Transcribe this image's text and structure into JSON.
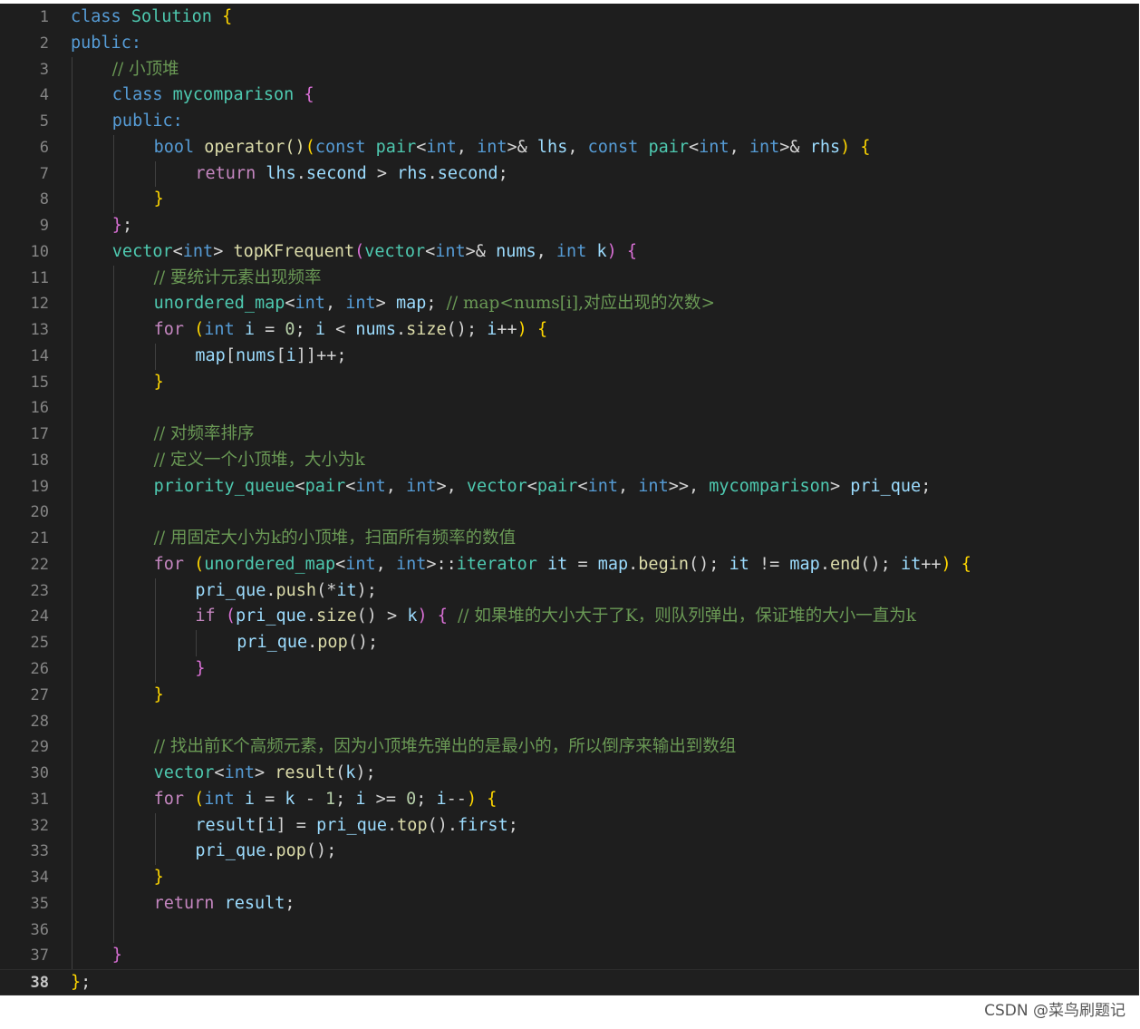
{
  "watermark": "CSDN @菜鸟刷题记",
  "active_line": 38,
  "lines": [
    {
      "n": "1",
      "indent": 0,
      "tokens": [
        [
          "kw",
          "class"
        ],
        [
          "tx",
          " "
        ],
        [
          "ty",
          "Solution"
        ],
        [
          "tx",
          " "
        ],
        [
          "br",
          "{"
        ]
      ]
    },
    {
      "n": "2",
      "indent": 0,
      "tokens": [
        [
          "kw",
          "public:"
        ]
      ]
    },
    {
      "n": "3",
      "indent": 1,
      "tokens": [
        [
          "cm",
          "// 小顶堆"
        ]
      ]
    },
    {
      "n": "4",
      "indent": 1,
      "tokens": [
        [
          "kw",
          "class"
        ],
        [
          "tx",
          " "
        ],
        [
          "ty",
          "mycomparison"
        ],
        [
          "tx",
          " "
        ],
        [
          "br2",
          "{"
        ]
      ]
    },
    {
      "n": "5",
      "indent": 1,
      "tokens": [
        [
          "kw",
          "public:"
        ]
      ]
    },
    {
      "n": "6",
      "indent": 2,
      "tokens": [
        [
          "kw",
          "bool"
        ],
        [
          "tx",
          " "
        ],
        [
          "fn",
          "operator()"
        ],
        [
          "br",
          "("
        ],
        [
          "kw",
          "const"
        ],
        [
          "tx",
          " "
        ],
        [
          "ty",
          "pair"
        ],
        [
          "tx",
          "<"
        ],
        [
          "kw",
          "int"
        ],
        [
          "tx",
          ", "
        ],
        [
          "kw",
          "int"
        ],
        [
          "tx",
          ">& "
        ],
        [
          "vr",
          "lhs"
        ],
        [
          "tx",
          ", "
        ],
        [
          "kw",
          "const"
        ],
        [
          "tx",
          " "
        ],
        [
          "ty",
          "pair"
        ],
        [
          "tx",
          "<"
        ],
        [
          "kw",
          "int"
        ],
        [
          "tx",
          ", "
        ],
        [
          "kw",
          "int"
        ],
        [
          "tx",
          ">& "
        ],
        [
          "vr",
          "rhs"
        ],
        [
          "br",
          ")"
        ],
        [
          "tx",
          " "
        ],
        [
          "br",
          "{"
        ]
      ]
    },
    {
      "n": "7",
      "indent": 3,
      "tokens": [
        [
          "ctl",
          "return"
        ],
        [
          "tx",
          " "
        ],
        [
          "vr",
          "lhs"
        ],
        [
          "tx",
          "."
        ],
        [
          "vr",
          "second"
        ],
        [
          "tx",
          " > "
        ],
        [
          "vr",
          "rhs"
        ],
        [
          "tx",
          "."
        ],
        [
          "vr",
          "second"
        ],
        [
          "tx",
          ";"
        ]
      ]
    },
    {
      "n": "8",
      "indent": 2,
      "tokens": [
        [
          "br",
          "}"
        ]
      ]
    },
    {
      "n": "9",
      "indent": 1,
      "tokens": [
        [
          "br2",
          "}"
        ],
        [
          "tx",
          ";"
        ]
      ]
    },
    {
      "n": "10",
      "indent": 1,
      "tokens": [
        [
          "ty",
          "vector"
        ],
        [
          "tx",
          "<"
        ],
        [
          "kw",
          "int"
        ],
        [
          "tx",
          "> "
        ],
        [
          "fn",
          "topKFrequent"
        ],
        [
          "br2",
          "("
        ],
        [
          "ty",
          "vector"
        ],
        [
          "tx",
          "<"
        ],
        [
          "kw",
          "int"
        ],
        [
          "tx",
          ">& "
        ],
        [
          "vr",
          "nums"
        ],
        [
          "tx",
          ", "
        ],
        [
          "kw",
          "int"
        ],
        [
          "tx",
          " "
        ],
        [
          "vr",
          "k"
        ],
        [
          "br2",
          ")"
        ],
        [
          "tx",
          " "
        ],
        [
          "br2",
          "{"
        ]
      ]
    },
    {
      "n": "11",
      "indent": 2,
      "tokens": [
        [
          "cm",
          "// 要统计元素出现频率"
        ]
      ]
    },
    {
      "n": "12",
      "indent": 2,
      "tokens": [
        [
          "ty",
          "unordered_map"
        ],
        [
          "tx",
          "<"
        ],
        [
          "kw",
          "int"
        ],
        [
          "tx",
          ", "
        ],
        [
          "kw",
          "int"
        ],
        [
          "tx",
          "> "
        ],
        [
          "vr",
          "map"
        ],
        [
          "tx",
          "; "
        ],
        [
          "cm",
          "// map<nums[i],对应出现的次数>"
        ]
      ]
    },
    {
      "n": "13",
      "indent": 2,
      "tokens": [
        [
          "ctl",
          "for"
        ],
        [
          "tx",
          " "
        ],
        [
          "br",
          "("
        ],
        [
          "kw",
          "int"
        ],
        [
          "tx",
          " "
        ],
        [
          "vr",
          "i"
        ],
        [
          "tx",
          " = "
        ],
        [
          "nm",
          "0"
        ],
        [
          "tx",
          "; "
        ],
        [
          "vr",
          "i"
        ],
        [
          "tx",
          " < "
        ],
        [
          "vr",
          "nums"
        ],
        [
          "tx",
          "."
        ],
        [
          "fn",
          "size"
        ],
        [
          "tx",
          "(); "
        ],
        [
          "vr",
          "i"
        ],
        [
          "tx",
          "++"
        ],
        [
          "br",
          ")"
        ],
        [
          "tx",
          " "
        ],
        [
          "br",
          "{"
        ]
      ]
    },
    {
      "n": "14",
      "indent": 3,
      "tokens": [
        [
          "vr",
          "map"
        ],
        [
          "tx",
          "["
        ],
        [
          "vr",
          "nums"
        ],
        [
          "tx",
          "["
        ],
        [
          "vr",
          "i"
        ],
        [
          "tx",
          "]]++;"
        ]
      ]
    },
    {
      "n": "15",
      "indent": 2,
      "tokens": [
        [
          "br",
          "}"
        ]
      ]
    },
    {
      "n": "16",
      "indent": 2,
      "tokens": []
    },
    {
      "n": "17",
      "indent": 2,
      "tokens": [
        [
          "cm",
          "// 对频率排序"
        ]
      ]
    },
    {
      "n": "18",
      "indent": 2,
      "tokens": [
        [
          "cm",
          "// 定义一个小顶堆，大小为k"
        ]
      ]
    },
    {
      "n": "19",
      "indent": 2,
      "tokens": [
        [
          "ty",
          "priority_queue"
        ],
        [
          "tx",
          "<"
        ],
        [
          "ty",
          "pair"
        ],
        [
          "tx",
          "<"
        ],
        [
          "kw",
          "int"
        ],
        [
          "tx",
          ", "
        ],
        [
          "kw",
          "int"
        ],
        [
          "tx",
          ">, "
        ],
        [
          "ty",
          "vector"
        ],
        [
          "tx",
          "<"
        ],
        [
          "ty",
          "pair"
        ],
        [
          "tx",
          "<"
        ],
        [
          "kw",
          "int"
        ],
        [
          "tx",
          ", "
        ],
        [
          "kw",
          "int"
        ],
        [
          "tx",
          ">>, "
        ],
        [
          "ty",
          "mycomparison"
        ],
        [
          "tx",
          "> "
        ],
        [
          "vr",
          "pri_que"
        ],
        [
          "tx",
          ";"
        ]
      ]
    },
    {
      "n": "20",
      "indent": 2,
      "tokens": []
    },
    {
      "n": "21",
      "indent": 2,
      "tokens": [
        [
          "cm",
          "// 用固定大小为k的小顶堆，扫面所有频率的数值"
        ]
      ]
    },
    {
      "n": "22",
      "indent": 2,
      "tokens": [
        [
          "ctl",
          "for"
        ],
        [
          "tx",
          " "
        ],
        [
          "br",
          "("
        ],
        [
          "ty",
          "unordered_map"
        ],
        [
          "tx",
          "<"
        ],
        [
          "kw",
          "int"
        ],
        [
          "tx",
          ", "
        ],
        [
          "kw",
          "int"
        ],
        [
          "tx",
          ">::"
        ],
        [
          "ty",
          "iterator"
        ],
        [
          "tx",
          " "
        ],
        [
          "vr",
          "it"
        ],
        [
          "tx",
          " = "
        ],
        [
          "vr",
          "map"
        ],
        [
          "tx",
          "."
        ],
        [
          "fn",
          "begin"
        ],
        [
          "tx",
          "(); "
        ],
        [
          "vr",
          "it"
        ],
        [
          "tx",
          " != "
        ],
        [
          "vr",
          "map"
        ],
        [
          "tx",
          "."
        ],
        [
          "fn",
          "end"
        ],
        [
          "tx",
          "(); "
        ],
        [
          "vr",
          "it"
        ],
        [
          "tx",
          "++"
        ],
        [
          "br",
          ")"
        ],
        [
          "tx",
          " "
        ],
        [
          "br",
          "{"
        ]
      ]
    },
    {
      "n": "23",
      "indent": 3,
      "tokens": [
        [
          "vr",
          "pri_que"
        ],
        [
          "tx",
          "."
        ],
        [
          "fn",
          "push"
        ],
        [
          "tx",
          "(*"
        ],
        [
          "vr",
          "it"
        ],
        [
          "tx",
          ");"
        ]
      ]
    },
    {
      "n": "24",
      "indent": 3,
      "tokens": [
        [
          "ctl",
          "if"
        ],
        [
          "tx",
          " "
        ],
        [
          "br2",
          "("
        ],
        [
          "vr",
          "pri_que"
        ],
        [
          "tx",
          "."
        ],
        [
          "fn",
          "size"
        ],
        [
          "tx",
          "() > "
        ],
        [
          "vr",
          "k"
        ],
        [
          "br2",
          ")"
        ],
        [
          "tx",
          " "
        ],
        [
          "br2",
          "{"
        ],
        [
          "tx",
          " "
        ],
        [
          "cm",
          "// 如果堆的大小大于了K，则队列弹出，保证堆的大小一直为k"
        ]
      ]
    },
    {
      "n": "25",
      "indent": 4,
      "tokens": [
        [
          "vr",
          "pri_que"
        ],
        [
          "tx",
          "."
        ],
        [
          "fn",
          "pop"
        ],
        [
          "tx",
          "();"
        ]
      ]
    },
    {
      "n": "26",
      "indent": 3,
      "tokens": [
        [
          "br2",
          "}"
        ]
      ]
    },
    {
      "n": "27",
      "indent": 2,
      "tokens": [
        [
          "br",
          "}"
        ]
      ]
    },
    {
      "n": "28",
      "indent": 2,
      "tokens": []
    },
    {
      "n": "29",
      "indent": 2,
      "tokens": [
        [
          "cm",
          "// 找出前K个高频元素，因为小顶堆先弹出的是最小的，所以倒序来输出到数组"
        ]
      ]
    },
    {
      "n": "30",
      "indent": 2,
      "tokens": [
        [
          "ty",
          "vector"
        ],
        [
          "tx",
          "<"
        ],
        [
          "kw",
          "int"
        ],
        [
          "tx",
          "> "
        ],
        [
          "fn",
          "result"
        ],
        [
          "tx",
          "("
        ],
        [
          "vr",
          "k"
        ],
        [
          "tx",
          ");"
        ]
      ]
    },
    {
      "n": "31",
      "indent": 2,
      "tokens": [
        [
          "ctl",
          "for"
        ],
        [
          "tx",
          " "
        ],
        [
          "br",
          "("
        ],
        [
          "kw",
          "int"
        ],
        [
          "tx",
          " "
        ],
        [
          "vr",
          "i"
        ],
        [
          "tx",
          " = "
        ],
        [
          "vr",
          "k"
        ],
        [
          "tx",
          " - "
        ],
        [
          "nm",
          "1"
        ],
        [
          "tx",
          "; "
        ],
        [
          "vr",
          "i"
        ],
        [
          "tx",
          " >= "
        ],
        [
          "nm",
          "0"
        ],
        [
          "tx",
          "; "
        ],
        [
          "vr",
          "i"
        ],
        [
          "tx",
          "--"
        ],
        [
          "br",
          ")"
        ],
        [
          "tx",
          " "
        ],
        [
          "br",
          "{"
        ]
      ]
    },
    {
      "n": "32",
      "indent": 3,
      "tokens": [
        [
          "vr",
          "result"
        ],
        [
          "tx",
          "["
        ],
        [
          "vr",
          "i"
        ],
        [
          "tx",
          "] = "
        ],
        [
          "vr",
          "pri_que"
        ],
        [
          "tx",
          "."
        ],
        [
          "fn",
          "top"
        ],
        [
          "tx",
          "()."
        ],
        [
          "vr",
          "first"
        ],
        [
          "tx",
          ";"
        ]
      ]
    },
    {
      "n": "33",
      "indent": 3,
      "tokens": [
        [
          "vr",
          "pri_que"
        ],
        [
          "tx",
          "."
        ],
        [
          "fn",
          "pop"
        ],
        [
          "tx",
          "();"
        ]
      ]
    },
    {
      "n": "34",
      "indent": 2,
      "tokens": [
        [
          "br",
          "}"
        ]
      ]
    },
    {
      "n": "35",
      "indent": 2,
      "tokens": [
        [
          "ctl",
          "return"
        ],
        [
          "tx",
          " "
        ],
        [
          "vr",
          "result"
        ],
        [
          "tx",
          ";"
        ]
      ]
    },
    {
      "n": "36",
      "indent": 2,
      "tokens": []
    },
    {
      "n": "37",
      "indent": 1,
      "tokens": [
        [
          "br2",
          "}"
        ]
      ]
    },
    {
      "n": "38",
      "indent": 0,
      "tokens": [
        [
          "br",
          "}"
        ],
        [
          "tx",
          ";"
        ]
      ]
    }
  ]
}
